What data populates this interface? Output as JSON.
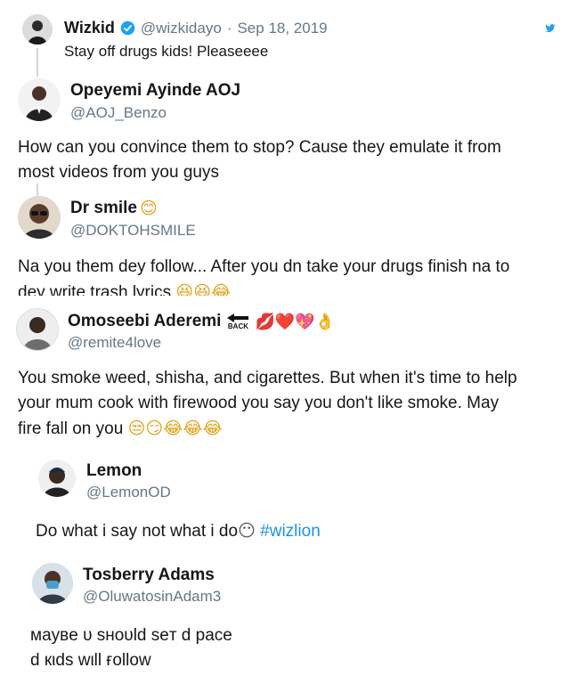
{
  "tweet1": {
    "name": "Wizkid",
    "handle": "@wizkidayo",
    "separator": "·",
    "date": "Sep 18, 2019",
    "text": "Stay off drugs kids! Pleaseeee"
  },
  "tweet2": {
    "name": "Opeyemi Ayinde AOJ",
    "handle": "@AOJ_Benzo",
    "text_line1": "How can you convince them to stop? Cause they emulate it from",
    "text_line2": "most videos from you guys"
  },
  "tweet3": {
    "name": "Dr smile",
    "name_emoji": "😊",
    "handle": "@DOKTOHSMILE",
    "text_line1": "Na you them dey follow... After you dn take your drugs finish na to",
    "text_line2": "dey write trash lyrics",
    "text_emojis": "😆😆😂"
  },
  "tweet4": {
    "name": "Omoseebi Aderemi",
    "back_label": "BACK",
    "name_emojis": "💋❤️💖👌",
    "handle": "@remite4love",
    "text_line1": "You smoke weed, shisha, and cigarettes. But when it's time to help",
    "text_line2": "your mum cook with firewood you say you don't like smoke. May",
    "text_line3": "fire fall on you",
    "text_emojis": "😒😏😂😂😂"
  },
  "tweet5": {
    "name": "Lemon",
    "handle": "@LemonOD",
    "text": "Do what i say not what i do",
    "emoji": "😶",
    "hashtag": "#wizlion"
  },
  "tweet6": {
    "name": "Tosberry Adams",
    "handle": "@OluwatosinAdam3",
    "text_line1": "мaувe υ ѕнoυld ѕeт d pace",
    "text_line2": "d кιdѕ wιll ғollow"
  },
  "colors": {
    "verified": "#1da1f2",
    "hashtag": "#1b95e0",
    "handle": "#657786",
    "thread_line": "#ccd6dd"
  }
}
